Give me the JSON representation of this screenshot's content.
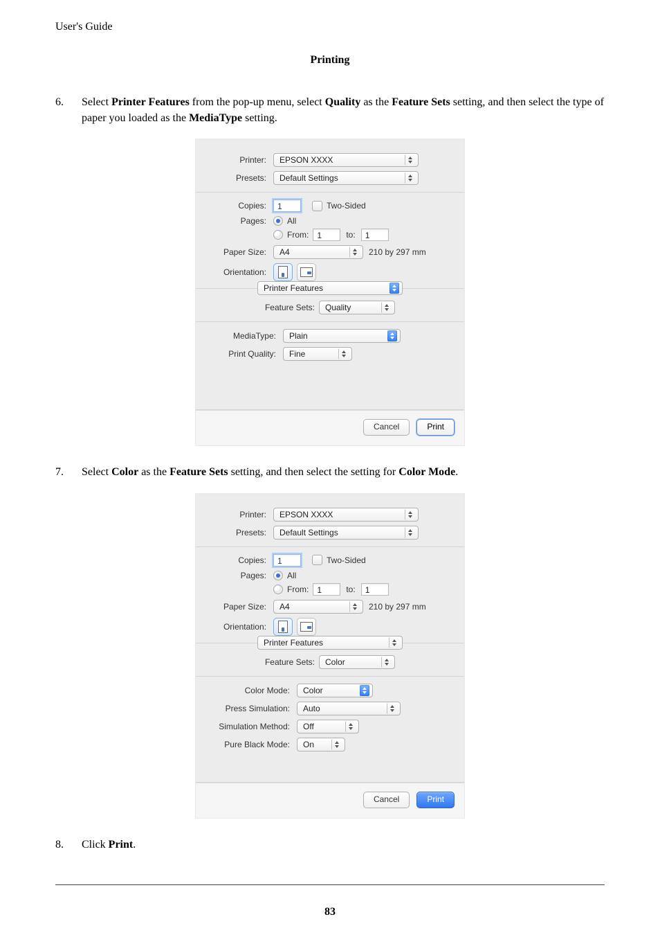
{
  "header": {
    "guide": "User's Guide",
    "section": "Printing"
  },
  "page_number": "83",
  "step6": {
    "num": "6.",
    "t1": "Select ",
    "b1": "Printer Features",
    "t2": " from the pop-up menu, select ",
    "b2": "Quality",
    "t3": " as the ",
    "b3": "Feature Sets",
    "t4": " setting, and then select the type of paper you loaded as the ",
    "b4": "MediaType",
    "t5": " setting."
  },
  "step7": {
    "num": "7.",
    "t1": "Select ",
    "b1": "Color",
    "t2": " as the ",
    "b2": "Feature Sets",
    "t3": " setting, and then select the setting for ",
    "b3": "Color Mode",
    "t4": "."
  },
  "step8": {
    "num": "8.",
    "t1": "Click ",
    "b1": "Print",
    "t2": "."
  },
  "dlg": {
    "labels": {
      "printer": "Printer:",
      "presets": "Presets:",
      "copies": "Copies:",
      "pages": "Pages:",
      "papersize": "Paper Size:",
      "orientation": "Orientation:",
      "featuresets": "Feature Sets:",
      "mediatype": "MediaType:",
      "printquality": "Print Quality:",
      "colormode": "Color Mode:",
      "presssim": "Press Simulation:",
      "simmethod": "Simulation Method:",
      "pureblack": "Pure Black Mode:",
      "from": "From:",
      "to": "to:",
      "all": "All",
      "twosided": "Two-Sided"
    },
    "values": {
      "printer": "EPSON XXXX",
      "presets": "Default Settings",
      "copies": "1",
      "page_from": "1",
      "page_to": "1",
      "papersize": "A4",
      "paperdim": "210 by 297 mm",
      "printer_features": "Printer Features",
      "featuresets_quality": "Quality",
      "featuresets_color": "Color",
      "mediatype": "Plain",
      "printquality": "Fine",
      "colormode": "Color",
      "presssim": "Auto",
      "simmethod": "Off",
      "pureblack": "On"
    },
    "buttons": {
      "cancel": "Cancel",
      "print": "Print"
    }
  }
}
